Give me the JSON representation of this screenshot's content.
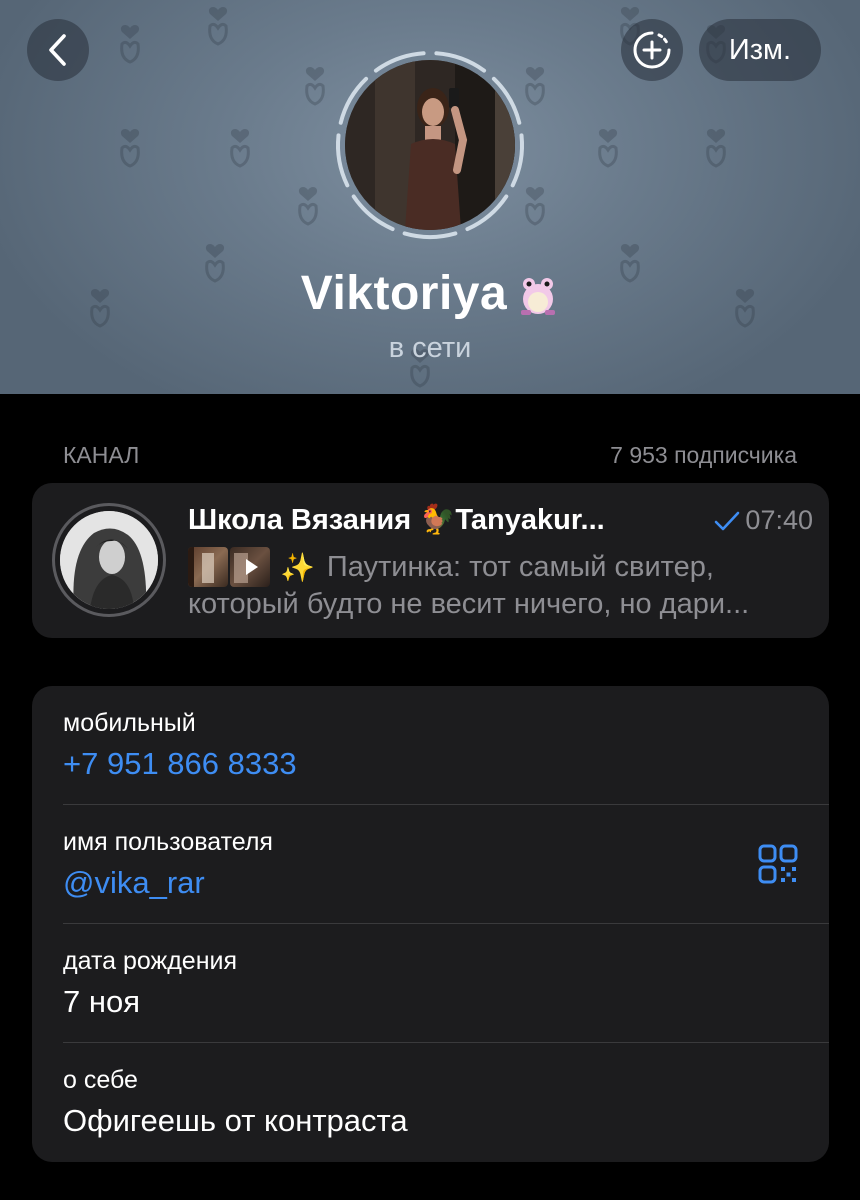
{
  "header": {
    "back_icon": "chevron-left-icon",
    "add_icon": "plus-circle-icon",
    "edit_label": "Изм.",
    "name": "Viktoriya",
    "emoji_status": "pink-frog-emoji",
    "status": "в сети",
    "background_color": "#6a7b8c"
  },
  "channel": {
    "section_label": "КАНАЛ",
    "subscribers": "7 953 подписчика",
    "title": "Школа Вязания 🐓Tanyakur...",
    "time": "07:40",
    "read_icon": "checkmark-icon",
    "preview_icon": "sparkles-icon",
    "preview_line1": "Паутинка: тот самый свитер,",
    "preview_line2": "который будто не весит ничего, но дари..."
  },
  "info": {
    "mobile_label": "мобильный",
    "mobile_value": "+7 951 866 8333",
    "username_label": "имя пользователя",
    "username_value": "@vika_rar",
    "username_icon": "qr-code-icon",
    "birthday_label": "дата рождения",
    "birthday_value": "7 ноя",
    "bio_label": "о себе",
    "bio_value": "Офигеешь от контраста",
    "link_color": "#3e8df3"
  }
}
